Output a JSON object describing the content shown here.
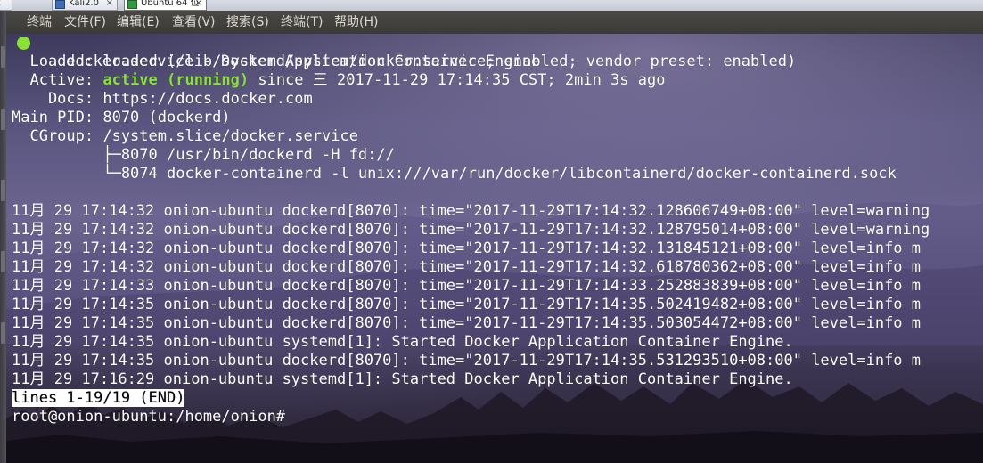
{
  "tabs": [
    {
      "label": "x",
      "close": ""
    },
    {
      "label": "Kali2.0",
      "close": "×"
    },
    {
      "label": "Ubuntu 64 位",
      "close": "×"
    }
  ],
  "menubar": {
    "items": [
      "终端",
      "文件(F)",
      "编辑(E)",
      "查看(V)",
      "搜索(S)",
      "终端(T)",
      "帮助(H)"
    ]
  },
  "terminal": {
    "status": {
      "service_line": "docker.service - Docker Application Container Engine",
      "loaded_line": "  Loaded: loaded (/lib/systemd/system/docker.service; enabled; vendor preset: enabled)",
      "active_label": "  Active: ",
      "active_state": "active (running)",
      "active_rest": " since 三 2017-11-29 17:14:35 CST; 2min 3s ago",
      "docs_line": "    Docs: https://docs.docker.com",
      "pid_line": "Main PID: 8070 (dockerd)",
      "cgroup_line": "  CGroup: /system.slice/docker.service",
      "cgroup_children": [
        "          ├─8070 /usr/bin/dockerd -H fd://",
        "          └─8074 docker-containerd -l unix:///var/run/docker/libcontainerd/docker-containerd.sock"
      ]
    },
    "log_lines": [
      "11月 29 17:14:32 onion-ubuntu dockerd[8070]: time=\"2017-11-29T17:14:32.128606749+08:00\" level=warning",
      "11月 29 17:14:32 onion-ubuntu dockerd[8070]: time=\"2017-11-29T17:14:32.128795014+08:00\" level=warning",
      "11月 29 17:14:32 onion-ubuntu dockerd[8070]: time=\"2017-11-29T17:14:32.131845121+08:00\" level=info m",
      "11月 29 17:14:32 onion-ubuntu dockerd[8070]: time=\"2017-11-29T17:14:32.618780362+08:00\" level=info m",
      "11月 29 17:14:33 onion-ubuntu dockerd[8070]: time=\"2017-11-29T17:14:33.252883839+08:00\" level=info m",
      "11月 29 17:14:35 onion-ubuntu dockerd[8070]: time=\"2017-11-29T17:14:35.502419482+08:00\" level=info m",
      "11月 29 17:14:35 onion-ubuntu dockerd[8070]: time=\"2017-11-29T17:14:35.503054472+08:00\" level=info m",
      "11月 29 17:14:35 onion-ubuntu systemd[1]: Started Docker Application Container Engine.",
      "11月 29 17:14:35 onion-ubuntu dockerd[8070]: time=\"2017-11-29T17:14:35.531293510+08:00\" level=info m",
      "11月 29 17:16:29 onion-ubuntu systemd[1]: Started Docker Application Container Engine."
    ],
    "pager_status": "lines 1-19/19 (END)",
    "prompt": "root@onion-ubuntu:/home/onion#"
  },
  "colors": {
    "active_green": "#8ae234",
    "status_dot": "#8ae234",
    "menubar_bg": "#3b3a37"
  }
}
